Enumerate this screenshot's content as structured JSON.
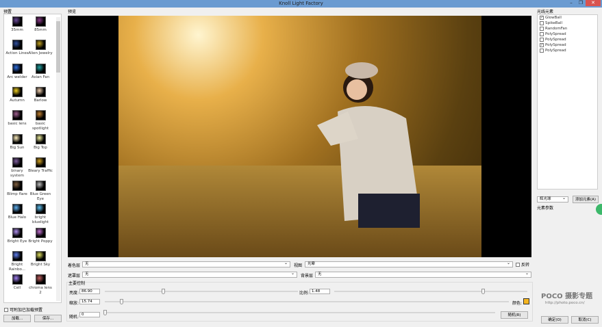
{
  "window": {
    "title": "Knoll Light Factory",
    "minimize": "–",
    "maximize": "❐",
    "close": "✕"
  },
  "presets": {
    "label": "预置",
    "items": [
      "35mm",
      "85mm",
      "Action Lines",
      "Alien Jewelry",
      "Arc welder",
      "Asian Fan",
      "Autumn",
      "Barlow",
      "basic lens",
      "basic spotlight",
      "Big Sun",
      "Big Top",
      "binary system",
      "Bleary Traffic",
      "Blimp flare",
      "Blue Green Eye",
      "Blue Halo",
      "bright bluelight",
      "Bright Eye",
      "Bright Poppy",
      "Bright Rainbo...",
      "Bright Sky",
      "Cell",
      "chroma lens 2"
    ],
    "append_label": "可附加已加载预置",
    "load": "加载...",
    "save": "保存..."
  },
  "preview": {
    "label": "预览"
  },
  "layers": {
    "tint_label": "着色层",
    "tint_value": "无",
    "view_label": "视图",
    "view_value": "光晕",
    "invert_label": "反转",
    "mask_label": "遮罩层",
    "mask_value": "无",
    "bg_label": "背景层",
    "bg_value": "无"
  },
  "controls": {
    "group_label": "主要控制",
    "brightness_label": "亮度:",
    "brightness": "86.90",
    "ratio_label": "比例:",
    "ratio": "1.48",
    "scale_label": "缩放:",
    "scale": "15.74",
    "color_label": "颜色:",
    "color": "#f5b51f",
    "random_label": "随机:",
    "random": "0",
    "random_button": "随机(R)",
    "brightness_frac": 0.3,
    "ratio_frac": 0.77,
    "scale_frac": 0.04,
    "random_frac": 0.0
  },
  "elements": {
    "label": "光线元素",
    "items": [
      {
        "name": "GlowBall",
        "checked": true
      },
      {
        "name": "SpikeBall",
        "checked": false
      },
      {
        "name": "RandomFan",
        "checked": false
      },
      {
        "name": "PolySpread",
        "checked": false
      },
      {
        "name": "PolySpread",
        "checked": false
      },
      {
        "name": "PolySpread",
        "checked": true
      },
      {
        "name": "PolySpread",
        "checked": false
      }
    ],
    "type_value": "辉光球",
    "add_button": "添加元素(A)",
    "params_label": "元素参数"
  },
  "logo": {
    "brand": "POCO 摄影专题",
    "url": "http://photo.poco.cn/"
  },
  "footer": {
    "ok": "确定(O)",
    "cancel": "取消(C)"
  }
}
